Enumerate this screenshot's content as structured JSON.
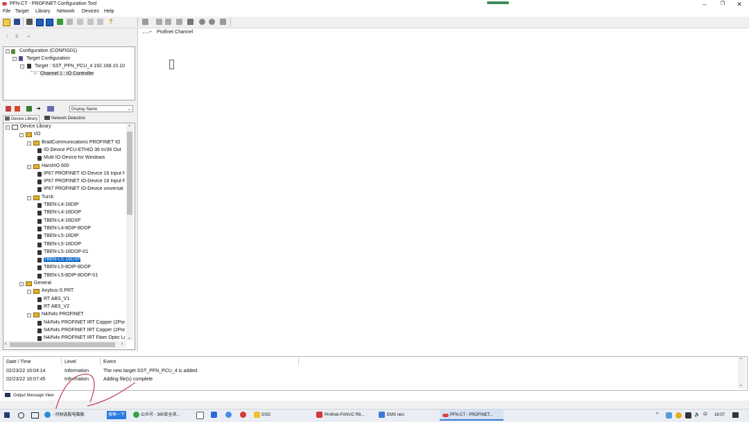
{
  "window": {
    "title": "PFN-CT - PROFINET Configuration Tool",
    "controls": {
      "minimize": "–",
      "maximize": "❐",
      "close": "✕"
    }
  },
  "menu": [
    "File",
    "Target",
    "Library",
    "Network",
    "Devices",
    "Help"
  ],
  "config_tree": {
    "root": "Configuration (CONFIG01)",
    "target_config": "Target Configuration",
    "target": "Target : SST_PFN_PCU_4  192.168.10.10",
    "channel": "Channel 1 : IO Controller"
  },
  "display_select": {
    "value": "Display Name"
  },
  "tabs": {
    "device_library": "Device Library",
    "network_detection": "Network Detection"
  },
  "device_library": {
    "root": "Device Library",
    "items": [
      {
        "label": "I/O",
        "level": 1,
        "kind": "folder"
      },
      {
        "label": "BradCommunications PROFINET IO",
        "level": 2,
        "kind": "folder"
      },
      {
        "label": "IO Device PCU-ETHIO 36 In/36 Out",
        "level": 3,
        "kind": "device"
      },
      {
        "label": "Multi IO-Device for Windows",
        "level": 3,
        "kind": "device"
      },
      {
        "label": "HarshIO 600",
        "level": 2,
        "kind": "folder"
      },
      {
        "label": "IP67 PROFINET IO-Device 16 Input N",
        "level": 3,
        "kind": "device"
      },
      {
        "label": "IP67 PROFINET IO-Device 16 Input Pl",
        "level": 3,
        "kind": "device"
      },
      {
        "label": "IP67 PROFINET IO-Device universal b",
        "level": 3,
        "kind": "device"
      },
      {
        "label": "Turck",
        "level": 2,
        "kind": "folder"
      },
      {
        "label": "TBEN-L4-16DIP",
        "level": 3,
        "kind": "device"
      },
      {
        "label": "TBEN-L4-16DOP",
        "level": 3,
        "kind": "device"
      },
      {
        "label": "TBEN-L4-16DXP",
        "level": 3,
        "kind": "device"
      },
      {
        "label": "TBEN-L4-8DIP-8DOP",
        "level": 3,
        "kind": "device"
      },
      {
        "label": "TBEN-L5-16DIP",
        "level": 3,
        "kind": "device"
      },
      {
        "label": "TBEN-L5-16DOP",
        "level": 3,
        "kind": "device"
      },
      {
        "label": "TBEN-L5-16DOP-01",
        "level": 3,
        "kind": "device"
      },
      {
        "label": "TBEN-L5-16DXP",
        "level": 3,
        "kind": "device",
        "selected": true
      },
      {
        "label": "TBEN-L5-8DIP-8DOP",
        "level": 3,
        "kind": "device"
      },
      {
        "label": "TBEN-L5-8DIP-8DOP-01",
        "level": 3,
        "kind": "device"
      },
      {
        "label": "General",
        "level": 1,
        "kind": "folder"
      },
      {
        "label": "Anybus-S PRT",
        "level": 2,
        "kind": "folder"
      },
      {
        "label": "RT ABS_V1",
        "level": 3,
        "kind": "device"
      },
      {
        "label": "RT ABS_V2",
        "level": 3,
        "kind": "device"
      },
      {
        "label": "N4/N4s PROFINET",
        "level": 2,
        "kind": "folder"
      },
      {
        "label": "N4/N4s PROFINET IRT Copper (2Por",
        "level": 3,
        "kind": "device"
      },
      {
        "label": "N4/N4s PROFINET IRT Copper (2Por",
        "level": 3,
        "kind": "device"
      },
      {
        "label": "N4/N4s PROFINET IRT Fiber Optic Le",
        "level": 3,
        "kind": "device"
      }
    ]
  },
  "right_pane": {
    "channel_label": "Profinet Channel"
  },
  "output": {
    "headers": [
      "Date / Time",
      "Level",
      "Event"
    ],
    "rows": [
      [
        "02/23/22 16:04:14",
        "Information",
        "The new target SST_PFN_PCU_4 is added."
      ],
      [
        "02/23/22 16:07:45",
        "Information",
        "Adding file(s) complete"
      ]
    ],
    "tab_label": "Output Message View"
  },
  "taskbar": {
    "browser_label": "- 问财选股电脑版",
    "search_button": "搜索一下",
    "tasks": [
      "公众号 - 360安全浏...",
      "GSD",
      "Profinet-FANUC R8...",
      "EMS neo",
      "PFN-CT - PROFINET..."
    ],
    "tray_ime": "中",
    "clock": "16:07"
  },
  "colors": {
    "selection": "#0a64c8",
    "accent": "#2a7ae0"
  }
}
